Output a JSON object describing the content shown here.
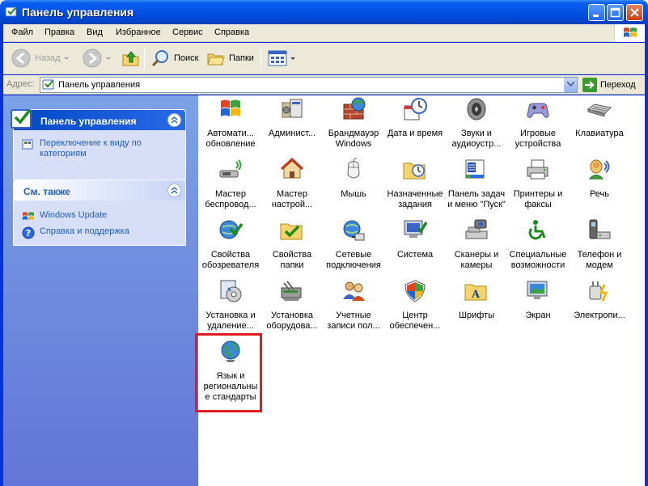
{
  "window": {
    "title": "Панель управления"
  },
  "menu": [
    "Файл",
    "Правка",
    "Вид",
    "Избранное",
    "Сервис",
    "Справка"
  ],
  "toolbar": {
    "back_label": "Назад",
    "search_label": "Поиск",
    "folders_label": "Папки"
  },
  "address": {
    "label": "Адрес:",
    "value": "Панель управления",
    "go_label": "Переход"
  },
  "taskpane": {
    "main_title": "Панель управления",
    "main_link": "Переключение к виду по категориям",
    "other_title": "См. также",
    "other_links": [
      "Windows Update",
      "Справка и поддержка"
    ]
  },
  "items": [
    {
      "label": "Автомати... обновление",
      "icon": "auto-update-icon"
    },
    {
      "label": "Админист...",
      "icon": "admin-tools-icon"
    },
    {
      "label": "Брандмауэр Windows",
      "icon": "firewall-icon"
    },
    {
      "label": "Дата и время",
      "icon": "clock-icon"
    },
    {
      "label": "Звуки и аудиоустр...",
      "icon": "speaker-icon"
    },
    {
      "label": "Игровые устройства",
      "icon": "gamepad-icon"
    },
    {
      "label": "Клавиатура",
      "icon": "keyboard-icon"
    },
    {
      "label": "Мастер беспровод...",
      "icon": "wireless-icon"
    },
    {
      "label": "Мастер настрой...",
      "icon": "network-setup-icon"
    },
    {
      "label": "Мышь",
      "icon": "mouse-icon"
    },
    {
      "label": "Назначенные задания",
      "icon": "scheduled-tasks-icon"
    },
    {
      "label": "Панель задач и меню \"Пуск\"",
      "icon": "taskbar-icon"
    },
    {
      "label": "Принтеры и факсы",
      "icon": "printer-icon"
    },
    {
      "label": "Речь",
      "icon": "speech-icon"
    },
    {
      "label": "Свойства обозревателя",
      "icon": "internet-options-icon"
    },
    {
      "label": "Свойства папки",
      "icon": "folder-options-icon"
    },
    {
      "label": "Сетевые подключения",
      "icon": "network-connections-icon"
    },
    {
      "label": "Система",
      "icon": "system-icon"
    },
    {
      "label": "Сканеры и камеры",
      "icon": "scanner-icon"
    },
    {
      "label": "Специальные возможности",
      "icon": "accessibility-icon"
    },
    {
      "label": "Телефон и модем",
      "icon": "phone-modem-icon"
    },
    {
      "label": "Установка и удаление...",
      "icon": "add-remove-icon"
    },
    {
      "label": "Установка оборудова...",
      "icon": "hardware-icon"
    },
    {
      "label": "Учетные записи пол...",
      "icon": "users-icon"
    },
    {
      "label": "Центр обеспечен...",
      "icon": "security-center-icon"
    },
    {
      "label": "Шрифты",
      "icon": "fonts-icon"
    },
    {
      "label": "Экран",
      "icon": "display-icon"
    },
    {
      "label": "Электропи...",
      "icon": "power-icon"
    },
    {
      "label": "Язык и региональные стандарты",
      "icon": "globe-icon"
    }
  ]
}
